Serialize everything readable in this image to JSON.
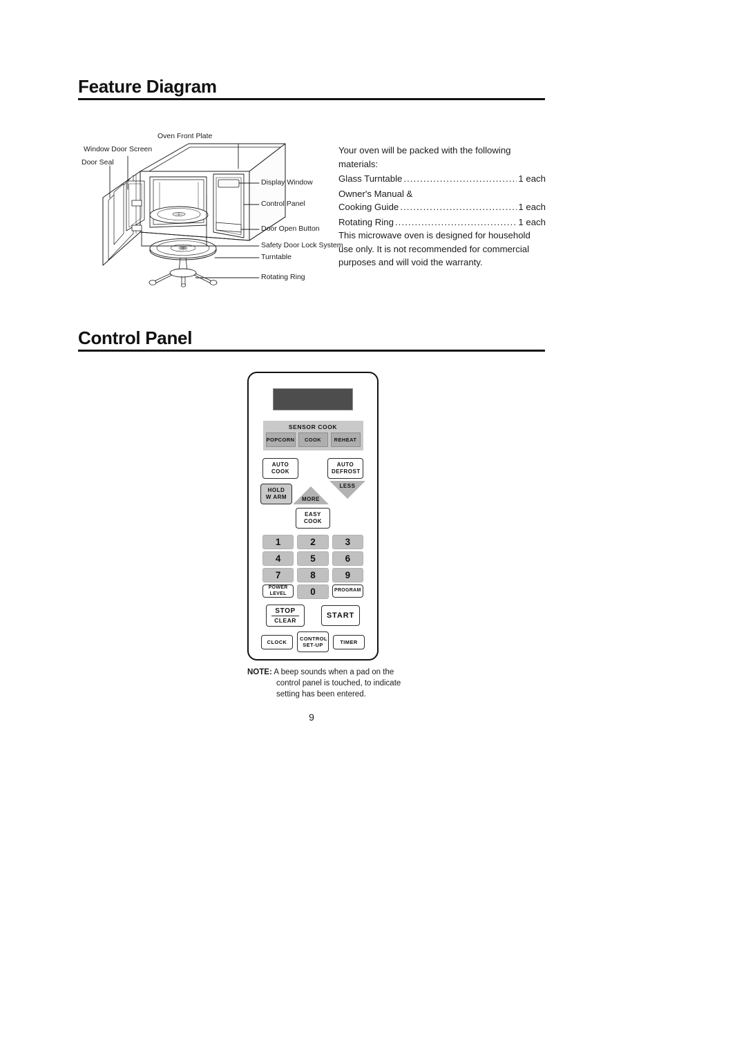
{
  "document": {
    "page_number": "9"
  },
  "sections": {
    "feature_diagram": {
      "heading": "Feature Diagram",
      "callouts": {
        "oven_front_plate": "Oven Front Plate",
        "window_door_screen": "Window Door Screen",
        "door_seal": "Door Seal",
        "display_window": "Display Window",
        "control_panel": "Control Panel",
        "door_open_button": "Door Open Button",
        "safety_door_lock_system": "Safety Door Lock System",
        "turntable": "Turntable",
        "rotating_ring": "Rotating Ring"
      },
      "packing_list": {
        "intro": "Your oven will be packed with the following materials:",
        "items": [
          {
            "name": "Glass Turntable",
            "qty": "1 each"
          },
          {
            "name": "Owner's Manual &",
            "qty": ""
          },
          {
            "name": "Cooking Guide",
            "qty": "1 each"
          },
          {
            "name": "Rotating Ring",
            "qty": "1 each"
          }
        ],
        "disclaimer": "This microwave oven is designed for household use only. It is not recommended for commercial purposes and will void the warranty."
      }
    },
    "control_panel": {
      "heading": "Control Panel",
      "display": {
        "label": "display-screen",
        "value": ""
      },
      "sensor_cook": {
        "title": "SENSOR COOK",
        "buttons": [
          "POPCORN",
          "COOK",
          "REHEAT"
        ]
      },
      "auto_row": [
        {
          "line1": "AUTO",
          "line2": "COOK"
        },
        {
          "line1": "AUTO",
          "line2": "DEFROST"
        }
      ],
      "hold_warm": {
        "line1": "HOLD",
        "line2": "W ARM"
      },
      "more": "MORE",
      "less": "LESS",
      "easy_cook": {
        "line1": "EASY",
        "line2": "COOK"
      },
      "numpad": [
        "1",
        "2",
        "3",
        "4",
        "5",
        "6",
        "7",
        "8",
        "9"
      ],
      "power_level": {
        "line1": "POWER",
        "line2": "LEVEL"
      },
      "zero": "0",
      "program": "PROGRAM",
      "stop_clear": {
        "top": "STOP",
        "bottom": "CLEAR"
      },
      "start": "START",
      "bottom_row": [
        {
          "line1": "CLOCK",
          "line2": ""
        },
        {
          "line1": "CONTROL",
          "line2": "SET-UP"
        },
        {
          "line1": "TIMER",
          "line2": ""
        }
      ],
      "note": {
        "label": "NOTE:",
        "line1": "A beep sounds when a pad on the",
        "line2": "control panel is touched, to indicate",
        "line3": "setting has been entered."
      }
    }
  },
  "colors": {
    "ink": "#1a1a1a",
    "rule": "#111111",
    "display_fill": "#4d4d4d",
    "sensor_group_fill": "#c9c9c9",
    "sensor_button_fill": "#aeaeae",
    "numkey_fill": "#c0c0c0",
    "triangle_fill": "#b3b3b3"
  }
}
